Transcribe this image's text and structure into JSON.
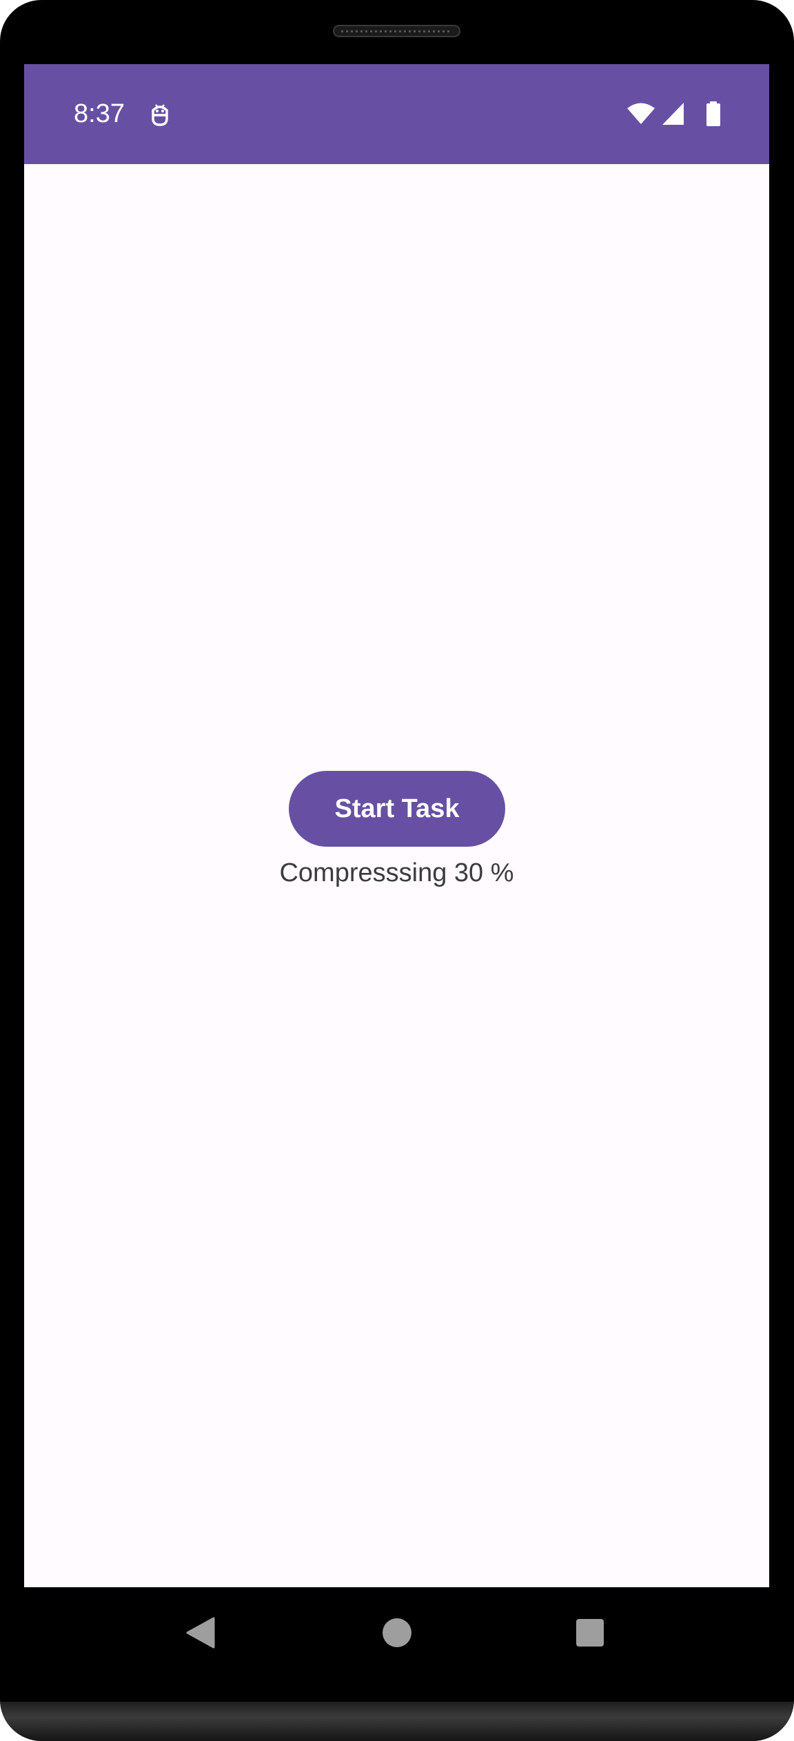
{
  "status_bar": {
    "time": "8:37",
    "background_color": "#6750a4",
    "icons": [
      "debug-icon",
      "wifi-icon",
      "signal-icon",
      "battery-icon"
    ]
  },
  "main": {
    "start_button_label": "Start Task",
    "progress_label": "Compresssing 30 %",
    "accent_color": "#6750a4",
    "background_color": "#fffbfe"
  },
  "nav_bar": {
    "icons": [
      "back-icon",
      "home-icon",
      "recents-icon"
    ]
  }
}
